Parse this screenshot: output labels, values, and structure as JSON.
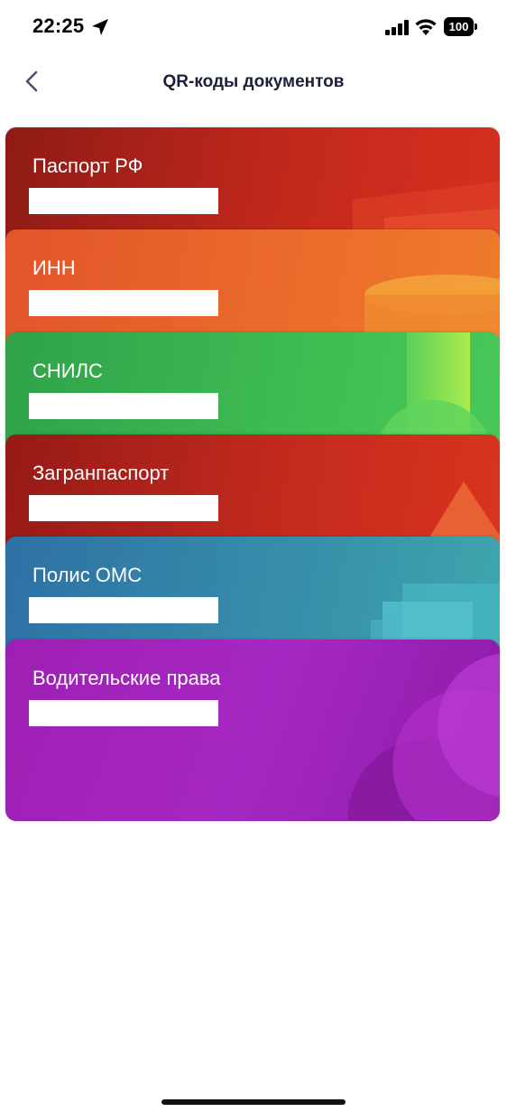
{
  "status_bar": {
    "time": "22:25",
    "battery": "100",
    "icons": [
      "location-arrow-icon",
      "signal-icon",
      "wifi-icon",
      "battery-icon"
    ]
  },
  "header": {
    "title": "QR-коды документов",
    "back_icon": "chevron-left-icon"
  },
  "colors": {
    "text_dark": "#1b1f3b",
    "passport": "#c1281c",
    "inn": "#eb6c2b",
    "snils": "#3fbc52",
    "foreign_passport": "#c32a1d",
    "oms": "#3790aa",
    "license": "#a628c2"
  },
  "documents": [
    {
      "title": "Паспорт РФ"
    },
    {
      "title": "ИНН"
    },
    {
      "title": "СНИЛС"
    },
    {
      "title": "Загранпаспорт"
    },
    {
      "title": "Полис ОМС"
    },
    {
      "title": "Водительские права"
    }
  ]
}
